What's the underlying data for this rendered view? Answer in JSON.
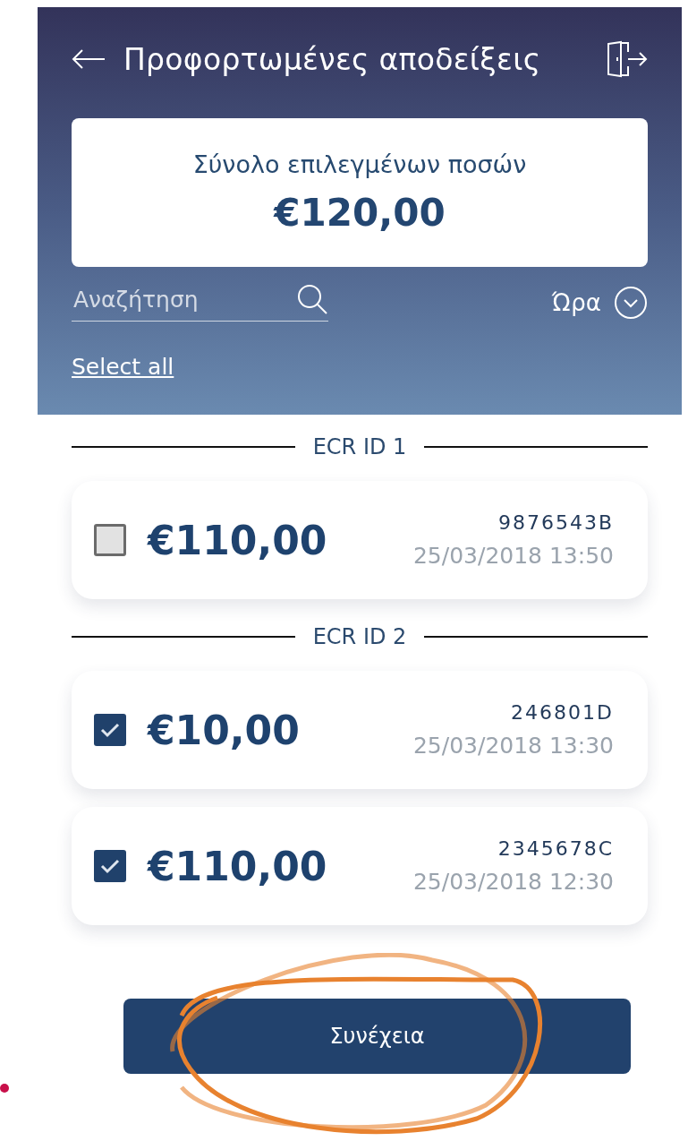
{
  "header": {
    "title": "Προφορτωμένες αποδείξεις"
  },
  "summary": {
    "label": "Σύνολο επιλεγμένων ποσών",
    "total": "€120,00"
  },
  "search": {
    "placeholder": "Αναζήτηση"
  },
  "sort": {
    "label": "Ώρα"
  },
  "select_all": "Select all",
  "groups": [
    {
      "label": "ECR ID 1",
      "receipts": [
        {
          "amount": "€110,00",
          "code": "9876543B",
          "datetime": "25/03/2018 13:50",
          "checked": false
        }
      ]
    },
    {
      "label": "ECR ID 2",
      "receipts": [
        {
          "amount": "€10,00",
          "code": "246801D",
          "datetime": "25/03/2018 13:30",
          "checked": true
        },
        {
          "amount": "€110,00",
          "code": "2345678C",
          "datetime": "25/03/2018 12:30",
          "checked": true
        }
      ]
    }
  ],
  "continue_button": "Συνέχεια"
}
